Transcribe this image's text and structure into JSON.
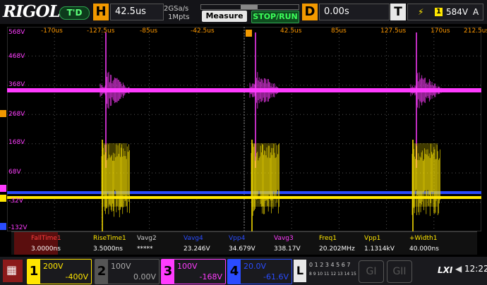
{
  "brand": "RIGOL",
  "trigger_status": "T'D",
  "horizontal": {
    "badge": "H",
    "timebase": "42.5us",
    "rate": "2GSa/s",
    "points": "1Mpts"
  },
  "buttons": {
    "measure": "Measure",
    "stop_run": "STOP/RUN"
  },
  "delay": {
    "badge": "D",
    "value": "0.00s"
  },
  "trigger": {
    "badge": "T",
    "source": "1",
    "level": "584V",
    "mode": "A"
  },
  "time_ticks": [
    "-170us",
    "-127.5us",
    "-85us",
    "-42.5us",
    "42.5us",
    "85us",
    "127.5us",
    "170us",
    "212.5us"
  ],
  "volt_ticks": [
    "568V",
    "468V",
    "368V",
    "268V",
    "168V",
    "68V",
    "-32V",
    "-132V"
  ],
  "measurements": [
    {
      "name": "FallTime1",
      "value": "3.0000ns",
      "color": "#ff3c3c"
    },
    {
      "name": "RiseTime1",
      "value": "3.5000ns",
      "color": "#ffe600"
    },
    {
      "name": "Vavg2",
      "value": "*****",
      "color": "#cfcfcf"
    },
    {
      "name": "Vavg4",
      "value": "23.246V",
      "color": "#2a4cff"
    },
    {
      "name": "Vpp4",
      "value": "34.679V",
      "color": "#2a4cff"
    },
    {
      "name": "Vavg3",
      "value": "338.17V",
      "color": "#ff3cff"
    },
    {
      "name": "Freq1",
      "value": "20.202MHz",
      "color": "#ffe600"
    },
    {
      "name": "Vpp1",
      "value": "1.1314kV",
      "color": "#ffe600"
    },
    {
      "name": "+Width1",
      "value": "40.000ns",
      "color": "#ffe600"
    }
  ],
  "channels": [
    {
      "num": "1",
      "scale": "200V",
      "offset": "-400V",
      "color": "#ffe600"
    },
    {
      "num": "2",
      "scale": "100V",
      "offset": "0.00V",
      "color": "#bdbdbd"
    },
    {
      "num": "3",
      "scale": "100V",
      "offset": "-168V",
      "color": "#ff3cff"
    },
    {
      "num": "4",
      "scale": "20.0V",
      "offset": "-61.6V",
      "color": "#2a4cff"
    }
  ],
  "logic": {
    "label": "L",
    "bits_top": "0 1 2 3 4 5 6 7",
    "bits_bottom": "8 9 10 11 12 13 14 15"
  },
  "ref_buttons": {
    "g1": "GI",
    "g2": "GII"
  },
  "lxi": "LXI",
  "clock": "12:22",
  "colors": {
    "ch1": "#ffe600",
    "ch3": "#ff3cff",
    "ch4": "#2a4cff",
    "accent": "#f29900"
  }
}
